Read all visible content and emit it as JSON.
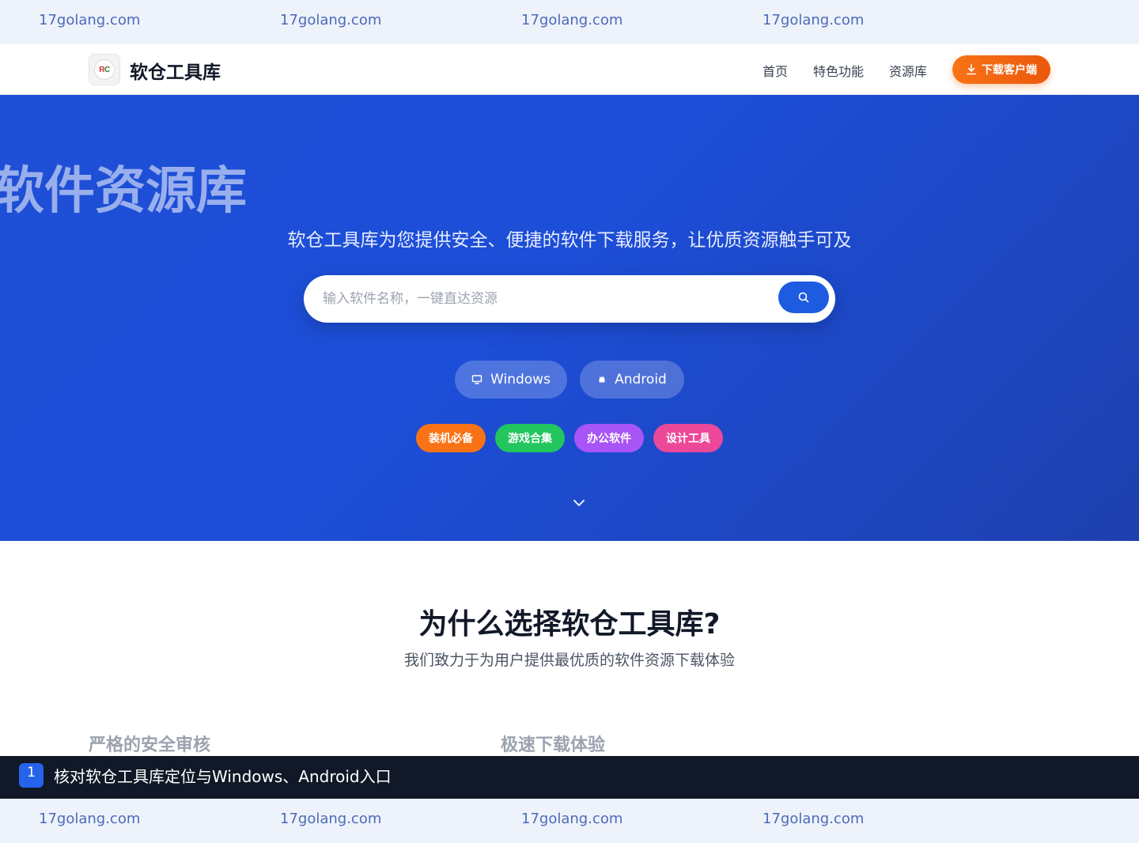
{
  "watermark": {
    "text": "17golang.com"
  },
  "header": {
    "logo_text_r": "R",
    "logo_text_c": "C",
    "brand": "软仓工具库",
    "nav": [
      "首页",
      "特色功能",
      "资源库"
    ],
    "download_button": "下载客户端"
  },
  "hero": {
    "big_title": "软件资源库",
    "subtitle": "软仓工具库为您提供安全、便捷的软件下载服务，让优质资源触手可及",
    "search_placeholder": "输入软件名称，一键直达资源",
    "search_value": "",
    "platforms": [
      {
        "label": "Windows",
        "icon": "monitor-icon"
      },
      {
        "label": "Android",
        "icon": "android-icon"
      }
    ],
    "tags": [
      {
        "label": "装机必备",
        "color": "#f97316"
      },
      {
        "label": "游戏合集",
        "color": "#22c55e"
      },
      {
        "label": "办公软件",
        "color": "#a855f7"
      },
      {
        "label": "设计工具",
        "color": "#ec4899"
      }
    ]
  },
  "why": {
    "title": "为什么选择软仓工具库?",
    "subtitle": "我们致力于为用户提供最优质的软件资源下载体验",
    "features": [
      "严格的安全审核",
      "极速下载体验"
    ]
  },
  "step": {
    "number": "1",
    "text": "核对软仓工具库定位与Windows、Android入口"
  },
  "colors": {
    "brand_blue": "#1d4ed8",
    "accent_orange": "#f97316"
  }
}
